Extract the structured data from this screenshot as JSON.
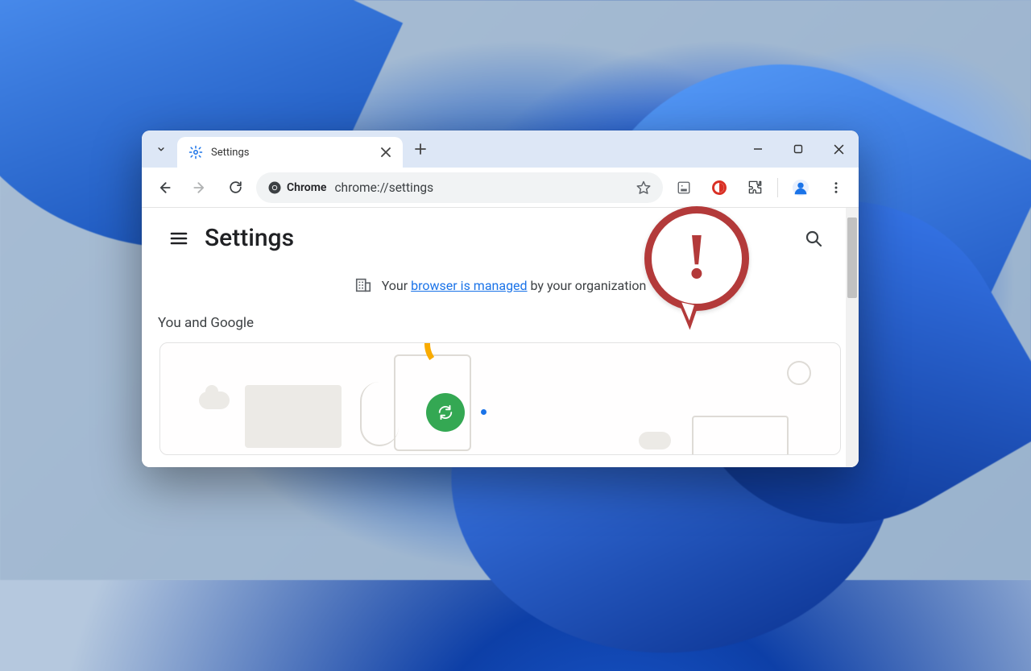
{
  "tab": {
    "title": "Settings",
    "icon": "settings-gear-icon"
  },
  "omnibox": {
    "chip_label": "Chrome",
    "url": "chrome://settings"
  },
  "page": {
    "title": "Settings",
    "managed_prefix": "Your ",
    "managed_link": "browser is managed",
    "managed_suffix": " by your organization",
    "section_label": "You and Google"
  },
  "colors": {
    "link": "#1a73e8",
    "callout": "#b33a3a",
    "green": "#34a853",
    "yellow": "#f9ab00"
  }
}
